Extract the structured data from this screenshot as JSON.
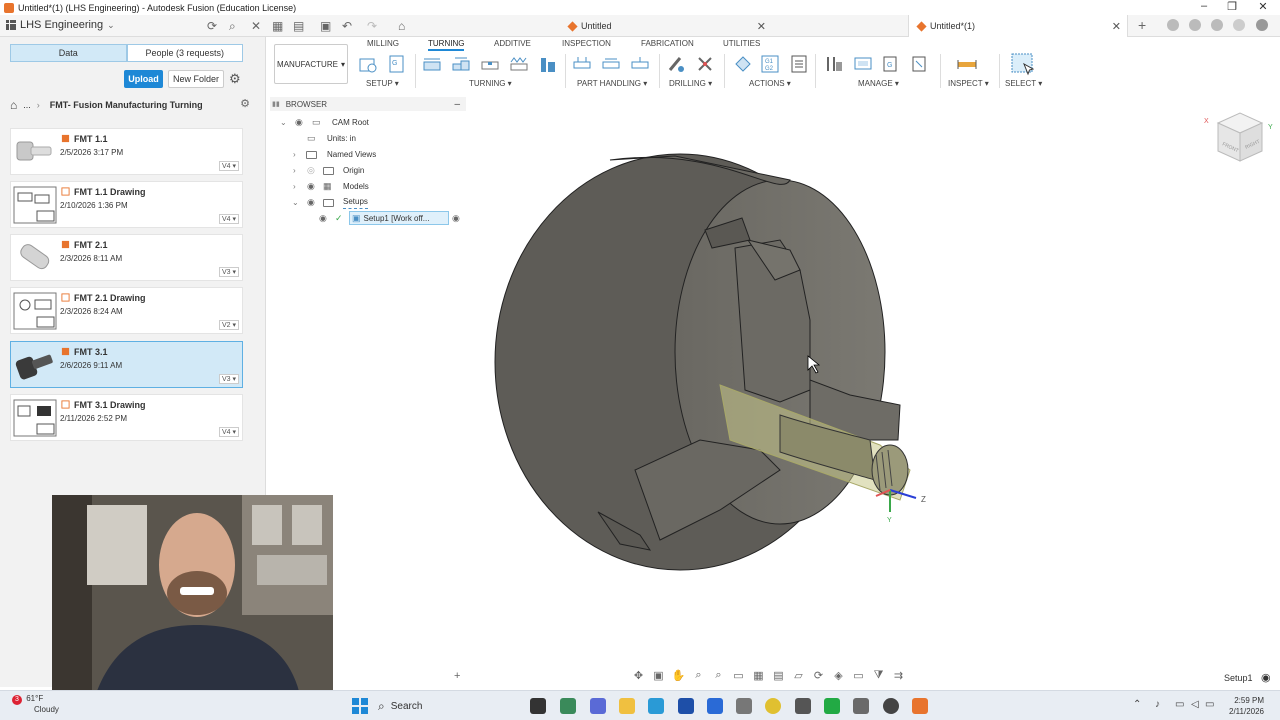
{
  "window": {
    "title": "Untitled*(1) (LHS Engineering) - Autodesk Fusion (Education License)"
  },
  "appbar": {
    "team": "LHS Engineering",
    "tabs": [
      {
        "label": "Untitled"
      },
      {
        "label": "Untitled*(1)"
      }
    ]
  },
  "data_panel": {
    "tab_data": "Data",
    "tab_people": "People (3 requests)",
    "upload_label": "Upload",
    "new_folder_label": "New Folder",
    "breadcrumb_ellipsis": "...",
    "project": "FMT- Fusion Manufacturing Turning",
    "files": [
      {
        "name": "FMT 1.1",
        "date": "2/5/2026 3:17 PM",
        "version": "V4 ▾",
        "type": "design"
      },
      {
        "name": "FMT 1.1 Drawing",
        "date": "2/10/2026 1:36 PM",
        "version": "V4 ▾",
        "type": "drawing"
      },
      {
        "name": "FMT 2.1",
        "date": "2/3/2026 8:11 AM",
        "version": "V3 ▾",
        "type": "design"
      },
      {
        "name": "FMT 2.1 Drawing",
        "date": "2/3/2026 8:24 AM",
        "version": "V2 ▾",
        "type": "drawing"
      },
      {
        "name": "FMT 3.1",
        "date": "2/6/2026 9:11 AM",
        "version": "V3 ▾",
        "type": "design",
        "selected": true
      },
      {
        "name": "FMT 3.1 Drawing",
        "date": "2/11/2026 2:52 PM",
        "version": "V4 ▾",
        "type": "drawing"
      }
    ]
  },
  "toolbar": {
    "workspace": "MANUFACTURE",
    "tabs": [
      "MILLING",
      "TURNING",
      "ADDITIVE",
      "INSPECTION",
      "FABRICATION",
      "UTILITIES"
    ],
    "active_tab": "TURNING",
    "groups": [
      "SETUP ▾",
      "TURNING ▾",
      "PART HANDLING ▾",
      "DRILLING ▾",
      "ACTIONS ▾",
      "MANAGE ▾",
      "INSPECT ▾",
      "SELECT ▾"
    ],
    "nc_icon_text": "G1\nG2"
  },
  "browser": {
    "title": "BROWSER",
    "items": [
      {
        "label": "CAM Root"
      },
      {
        "label": "Units: in"
      },
      {
        "label": "Named Views"
      },
      {
        "label": "Origin"
      },
      {
        "label": "Models"
      },
      {
        "label": "Setups"
      },
      {
        "label": "Setup1 [Work off..."
      }
    ]
  },
  "viewcube": {
    "x": "X",
    "y": "Y",
    "z": "Z",
    "face_front": "FRONT",
    "face_right": "RIGHT"
  },
  "triad": {
    "y": "Y",
    "z": "Z"
  },
  "status": {
    "setup": "Setup1"
  },
  "taskbar": {
    "weather_temp": "61°F",
    "weather_desc": "Cloudy",
    "weather_badge": "3",
    "search": "Search",
    "time": "2:59 PM",
    "date": "2/11/2026"
  },
  "colors": {
    "accent": "#1e88d6",
    "fusion_orange": "#e8742d",
    "chuck": "#6e6c66",
    "part": "#c8c890"
  }
}
